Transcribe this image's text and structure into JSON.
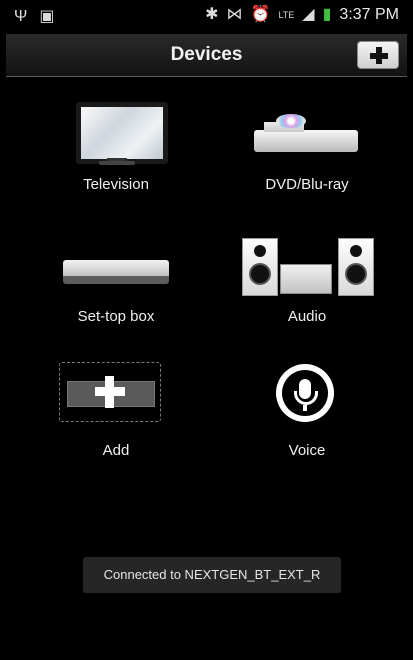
{
  "status_bar": {
    "left_icons": [
      "usb-icon",
      "gallery-icon"
    ],
    "right_icons": [
      "bluetooth-icon",
      "nfc-icon",
      "alarm-icon",
      "lte-icon",
      "signal-icon",
      "battery-icon"
    ],
    "network": "LTE",
    "time": "3:37 PM"
  },
  "header": {
    "title": "Devices",
    "add_button_icon": "plus-icon"
  },
  "devices": [
    {
      "label": "Television",
      "icon": "television-icon"
    },
    {
      "label": "DVD/Blu-ray",
      "icon": "dvd-player-icon"
    },
    {
      "label": "Set-top box",
      "icon": "set-top-box-icon"
    },
    {
      "label": "Audio",
      "icon": "audio-system-icon"
    },
    {
      "label": "Add",
      "icon": "add-device-icon"
    },
    {
      "label": "Voice",
      "icon": "microphone-icon"
    }
  ],
  "toast": {
    "message": "Connected to NEXTGEN_BT_EXT_R"
  },
  "colors": {
    "background": "#000000",
    "toast_background": "#262626",
    "text": "#ffffff"
  }
}
